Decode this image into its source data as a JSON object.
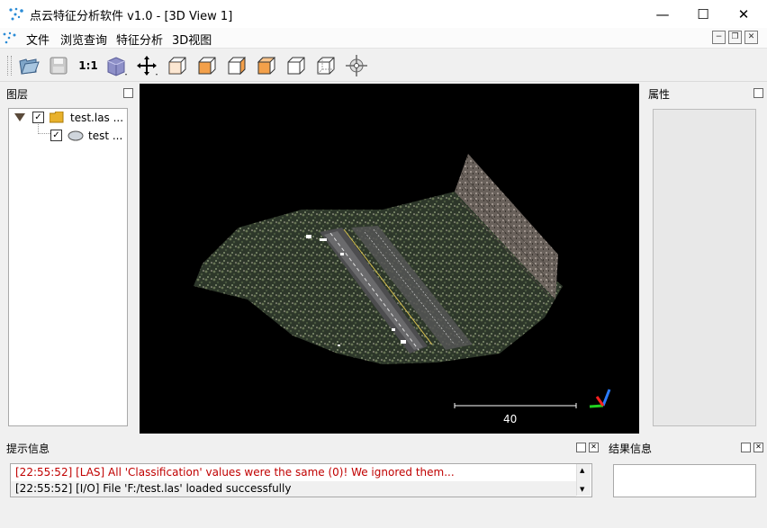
{
  "window": {
    "title": "点云特征分析软件 v1.0 - [3D View 1]",
    "minimize": "—",
    "maximize": "☐",
    "close": "✕"
  },
  "menu": {
    "items": [
      "文件",
      "浏览查询",
      "特征分析",
      "3D视图"
    ]
  },
  "mdi_controls": {
    "minimize": "−",
    "restore": "❐",
    "close": "✕"
  },
  "toolbar": {
    "zoom_label": "1:1",
    "icons": [
      "open-folder-icon",
      "save-icon",
      "zoom-1-1",
      "cube-solid-icon",
      "pan-icon",
      "view-front-icon",
      "view-top-icon",
      "view-left-icon",
      "view-right-icon",
      "view-back-icon",
      "view-bottom-icon",
      "pick-rotation-center-icon"
    ]
  },
  "layers_panel": {
    "title": "图层",
    "tree": [
      {
        "label": "test.las ...",
        "checked": true,
        "icon": "folder-icon"
      },
      {
        "label": "test ...",
        "checked": true,
        "icon": "cloud-icon"
      }
    ]
  },
  "properties_panel": {
    "title": "属性"
  },
  "viewer": {
    "scale_label": "40",
    "axis_colors": {
      "x": "#ff2020",
      "y": "#20d020",
      "z": "#2a7bff"
    }
  },
  "console": {
    "title": "提示信息",
    "lines": [
      {
        "text": "[22:55:52] [LAS] All 'Classification' values were the same (0)! We ignored them...",
        "color": "#c00000"
      },
      {
        "text": "[22:55:52] [I/O] File 'F:/test.las' loaded successfully",
        "color": "#000000"
      }
    ]
  },
  "results_panel": {
    "title": "结果信息"
  },
  "colors": {
    "warning_text": "#c00000",
    "viewer_bg": "#000000"
  }
}
